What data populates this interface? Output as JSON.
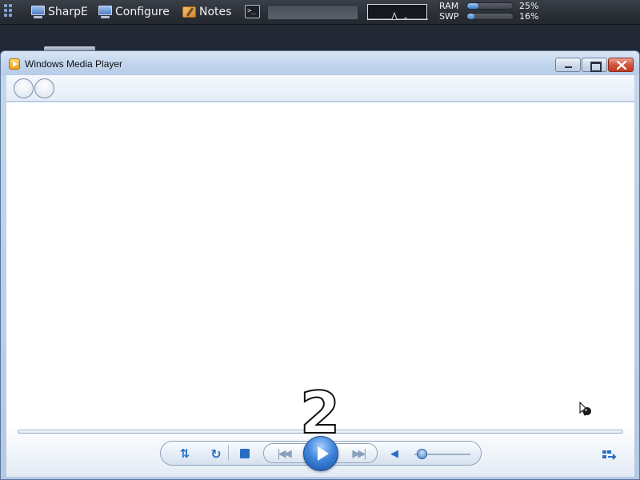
{
  "taskbar": {
    "items": [
      {
        "label": "SharpE",
        "icon": "monitor-icon"
      },
      {
        "label": "Configure",
        "icon": "monitor-icon"
      },
      {
        "label": "Notes",
        "icon": "notes-icon"
      }
    ],
    "terminal_label": ">_",
    "stats": {
      "ram": {
        "label": "RAM",
        "value": "25%",
        "fraction": 0.25
      },
      "swp": {
        "label": "SWP",
        "value": "16%",
        "fraction": 0.16
      }
    }
  },
  "window": {
    "title": "Windows Media Player",
    "icon": "media-player-icon"
  },
  "controls": {
    "shuffle_icon": "⇅",
    "repeat_icon": "↻",
    "prev_icon": "|◀◀",
    "next_icon": "▶▶|",
    "mute_icon": "◀",
    "volume_fraction": 0.05
  },
  "overlay": {
    "number": "2"
  },
  "colors": {
    "accent": "#2a6dc4",
    "close_button": "#c23a22",
    "taskbar": "#2b3038"
  }
}
